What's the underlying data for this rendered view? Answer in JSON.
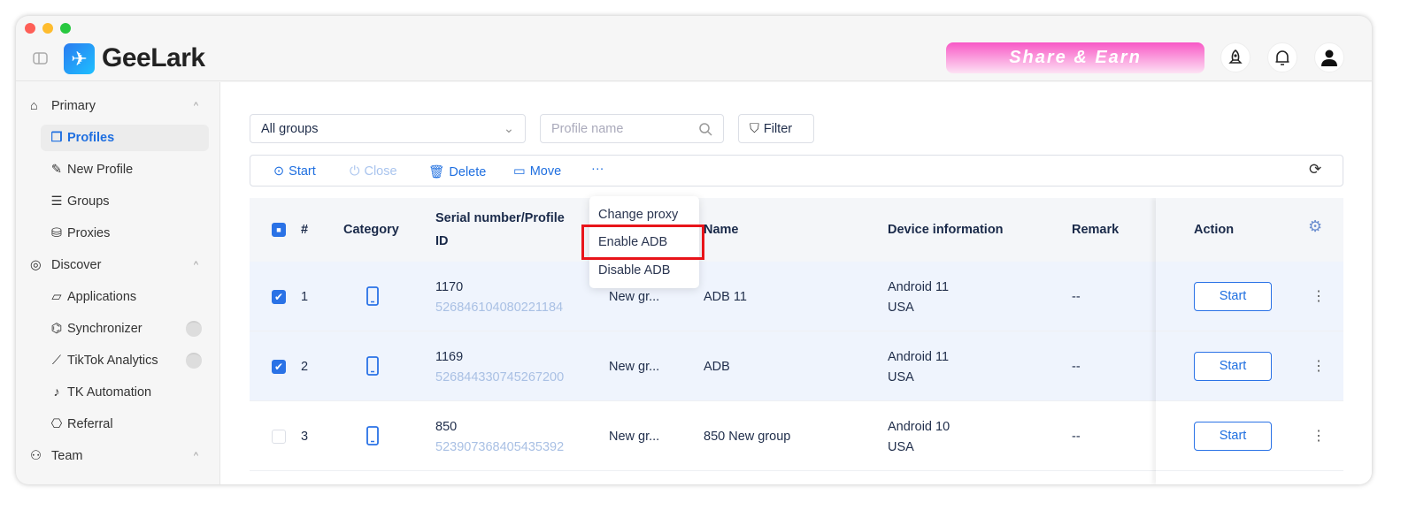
{
  "app": {
    "brand": "GeeLark",
    "share_banner": "Share & Earn"
  },
  "header_icons": [
    "rocket-icon",
    "bell-icon",
    "user-icon"
  ],
  "sidebar": {
    "sections": [
      {
        "label": "Primary",
        "items": [
          {
            "label": "Profiles",
            "active": true
          },
          {
            "label": "New Profile"
          },
          {
            "label": "Groups"
          },
          {
            "label": "Proxies"
          }
        ]
      },
      {
        "label": "Discover",
        "items": [
          {
            "label": "Applications"
          },
          {
            "label": "Synchronizer",
            "badge": true
          },
          {
            "label": "TikTok Analytics",
            "badge": true
          },
          {
            "label": "TK Automation"
          },
          {
            "label": "Referral"
          }
        ]
      },
      {
        "label": "Team",
        "items": []
      }
    ]
  },
  "filters": {
    "group_select": "All groups",
    "search_placeholder": "Profile name",
    "filter_label": "Filter"
  },
  "toolbar": {
    "start": "Start",
    "close": "Close",
    "delete": "Delete",
    "move": "Move",
    "more": "···"
  },
  "more_menu": {
    "items": [
      "Change proxy",
      "Enable ADB",
      "Disable ADB"
    ],
    "highlighted": "Enable ADB"
  },
  "table": {
    "headers": {
      "num": "#",
      "category": "Category",
      "serial": "Serial number/Profile",
      "serial2": "ID",
      "name": "Name",
      "device": "Device information",
      "remark": "Remark",
      "action": "Action"
    },
    "rows": [
      {
        "checked": true,
        "num": "1",
        "serial": "1170",
        "id": "526846104080221184",
        "group": "New gr...",
        "name": "ADB 11",
        "os": "Android 11",
        "country": "USA",
        "remark": "--",
        "action": "Start"
      },
      {
        "checked": true,
        "num": "2",
        "serial": "1169",
        "id": "526844330745267200",
        "group": "New gr...",
        "name": "ADB",
        "os": "Android 11",
        "country": "USA",
        "remark": "--",
        "action": "Start"
      },
      {
        "checked": false,
        "num": "3",
        "serial": "850",
        "id": "523907368405435392",
        "group": "New gr...",
        "name": "850 New group",
        "os": "Android 10",
        "country": "USA",
        "remark": "--",
        "action": "Start"
      }
    ]
  },
  "colors": {
    "accent": "#1f6fe0",
    "highlight": "#e8141a",
    "selected_row": "#eff4fd"
  }
}
